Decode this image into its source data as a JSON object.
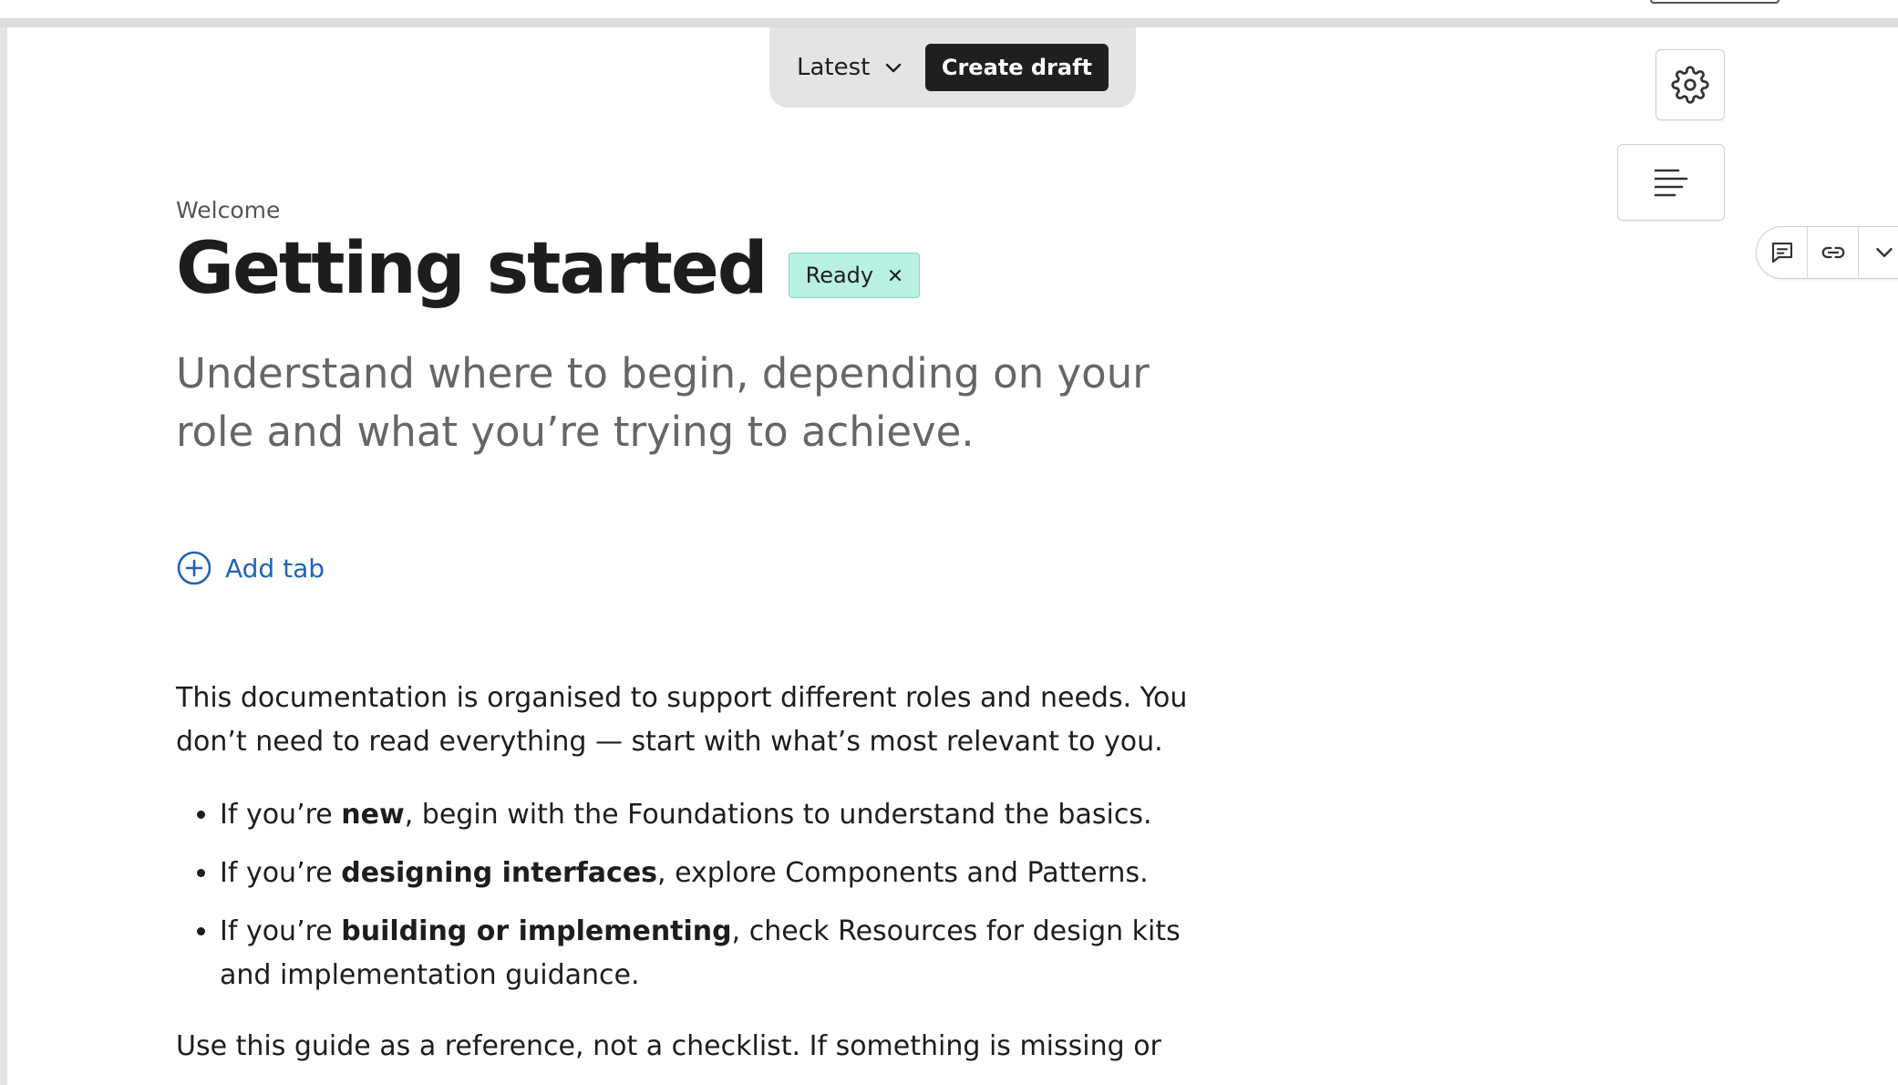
{
  "toolbar": {
    "version_label": "Latest",
    "create_draft_label": "Create draft"
  },
  "page": {
    "breadcrumb": "Welcome",
    "title": "Getting started",
    "status": "Ready",
    "subtitle": "Understand where to begin, depending on your role and what you’re trying to achieve."
  },
  "tabs": {
    "add_label": "Add tab"
  },
  "body": {
    "intro": "This documentation is organised to support different roles and needs. You don’t need to read everything — start with what’s most relevant to you.",
    "bullets": [
      {
        "prefix": "If you’re ",
        "bold": "new",
        "suffix": ", begin with the Foundations to understand the basics."
      },
      {
        "prefix": "If you’re ",
        "bold": "designing interfaces",
        "suffix": ", explore Components and Patterns."
      },
      {
        "prefix": "If you’re ",
        "bold": "building or implementing",
        "suffix": ", check Resources for design kits and implementation guidance."
      }
    ],
    "outro": "Use this guide as a reference, not a checklist. If something is missing or"
  },
  "icons": {
    "version": "chevron-down-icon",
    "settings": "gear-icon",
    "toc": "align-left-icon",
    "comment": "comment-icon",
    "link": "link-icon",
    "more": "chevron-down-icon",
    "badge_remove": "close-icon",
    "add_tab": "plus-circle-icon"
  },
  "colors": {
    "badge_bg": "#b8f0e2",
    "link": "#1f63b5",
    "button_dark": "#1f1f1f"
  }
}
